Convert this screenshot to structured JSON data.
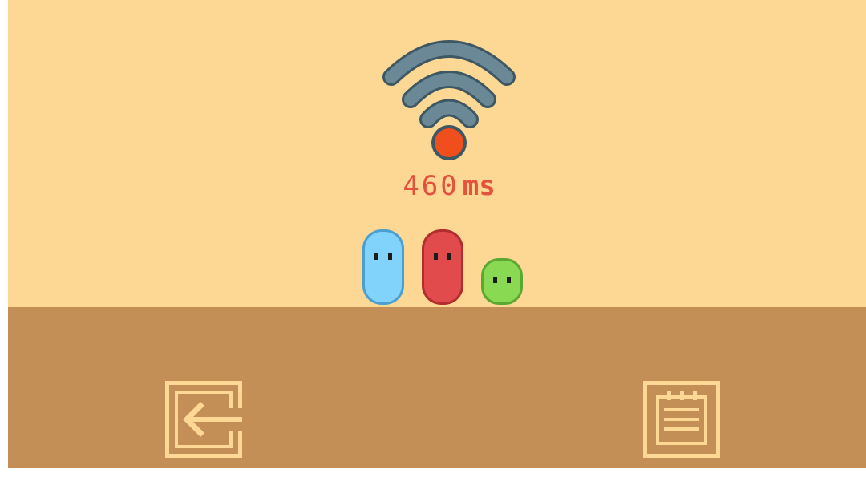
{
  "connection": {
    "latency_value": "460",
    "latency_unit": "ms",
    "signal_indicator_color": "#f04e1d",
    "signal_arc_color": "#5f7f8f"
  },
  "characters": [
    {
      "name": "blue",
      "color": "#82d3fb"
    },
    {
      "name": "red",
      "color": "#e24b4b"
    },
    {
      "name": "green",
      "color": "#8ad952"
    }
  ],
  "buttons": {
    "back_icon": "exit-arrow-icon",
    "notes_icon": "notepad-icon"
  },
  "colors": {
    "sky": "#fdd794",
    "ground": "#c38f57",
    "button_stroke": "#fdd794",
    "latency_text": "#e5513d"
  }
}
